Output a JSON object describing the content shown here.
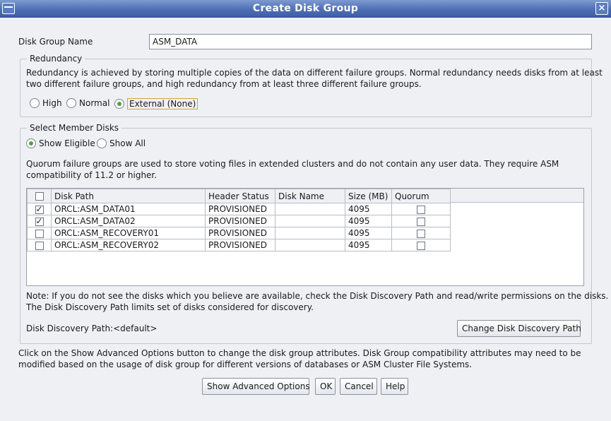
{
  "window": {
    "title": "Create Disk Group",
    "close_glyph": "×"
  },
  "disk_group_name": {
    "label": "Disk Group Name",
    "value": "ASM_DATA"
  },
  "redundancy": {
    "title": "Redundancy",
    "description_line1": "Redundancy is achieved by storing multiple copies of the data on different failure groups. Normal redundancy needs disks from at least",
    "description_line2": "two different failure groups, and high redundancy from at least three different failure groups.",
    "options": [
      {
        "label": "High",
        "selected": false
      },
      {
        "label": "Normal",
        "selected": false
      },
      {
        "label": "External (None)",
        "selected": true
      }
    ]
  },
  "member_disks": {
    "title": "Select Member Disks",
    "filters": [
      {
        "label": "Show Eligible",
        "selected": true
      },
      {
        "label": "Show All",
        "selected": false
      }
    ],
    "quorum_note_line1": "Quorum failure groups are used to store voting files in extended clusters and do not contain any user data. They require ASM",
    "quorum_note_line2": "compatibility of 11.2 or higher.",
    "columns": [
      "Disk Path",
      "Header Status",
      "Disk Name",
      "Size (MB)",
      "Quorum"
    ],
    "rows": [
      {
        "checked": true,
        "path": "ORCL:ASM_DATA01",
        "header_status": "PROVISIONED",
        "disk_name": "",
        "size": "4095",
        "quorum": false
      },
      {
        "checked": true,
        "path": "ORCL:ASM_DATA02",
        "header_status": "PROVISIONED",
        "disk_name": "",
        "size": "4095",
        "quorum": false
      },
      {
        "checked": false,
        "path": "ORCL:ASM_RECOVERY01",
        "header_status": "PROVISIONED",
        "disk_name": "",
        "size": "4095",
        "quorum": false
      },
      {
        "checked": false,
        "path": "ORCL:ASM_RECOVERY02",
        "header_status": "PROVISIONED",
        "disk_name": "",
        "size": "4095",
        "quorum": false
      }
    ],
    "discovery_note_line1": "Note: If you do not see the disks which you believe are available, check the Disk Discovery Path and read/write permissions on the disks.",
    "discovery_note_line2": "The Disk Discovery Path limits set of disks considered for discovery.",
    "discovery_path_label": "Disk Discovery Path:<default>",
    "change_path_button": "Change Disk Discovery Path"
  },
  "advanced_note_line1": "Click on the Show Advanced Options button to change the disk group attributes. Disk Group compatibility attributes may need to be",
  "advanced_note_line2": "modified based on the usage of disk group for different versions of databases or ASM Cluster File Systems.",
  "buttons": {
    "advanced": "Show Advanced Options",
    "ok": "OK",
    "cancel": "Cancel",
    "help": "Help"
  }
}
